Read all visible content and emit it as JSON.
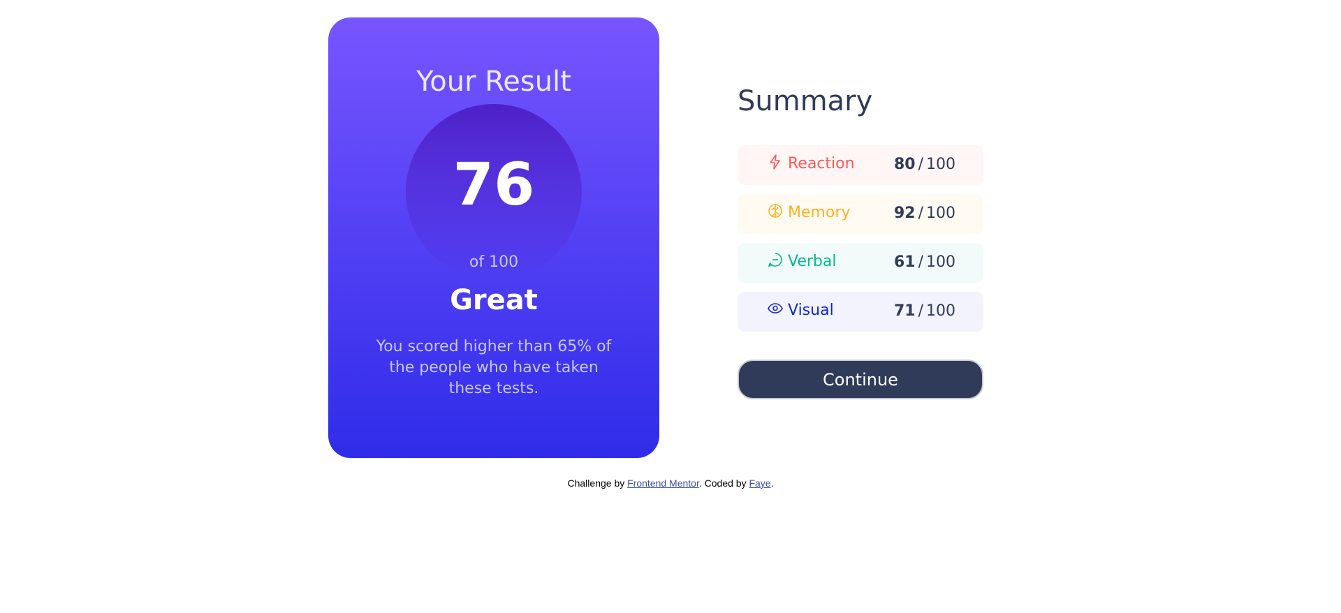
{
  "result": {
    "title": "Your Result",
    "score": "76",
    "out_of": "of 100",
    "rating": "Great",
    "description": "You scored higher than 65% of the people who have taken these tests."
  },
  "summary": {
    "title": "Summary",
    "items": [
      {
        "label": "Reaction",
        "score": "80",
        "total": "100",
        "icon": "lightning-icon",
        "color": "#ff5757",
        "bg": "#fff6f5"
      },
      {
        "label": "Memory",
        "score": "92",
        "total": "100",
        "icon": "brain-icon",
        "color": "#ffb01f",
        "bg": "#fffbf2"
      },
      {
        "label": "Verbal",
        "score": "61",
        "total": "100",
        "icon": "speech-bubble-icon",
        "color": "#00bb8f",
        "bg": "#f2fbfa"
      },
      {
        "label": "Visual",
        "score": "71",
        "total": "100",
        "icon": "eye-icon",
        "color": "#1125d6",
        "bg": "#f3f3fd"
      }
    ],
    "continue_label": "Continue"
  },
  "attribution": {
    "prefix": "Challenge by ",
    "link1": "Frontend Mentor",
    "middle": ". Coded by ",
    "link2": "Faye",
    "suffix": "."
  }
}
